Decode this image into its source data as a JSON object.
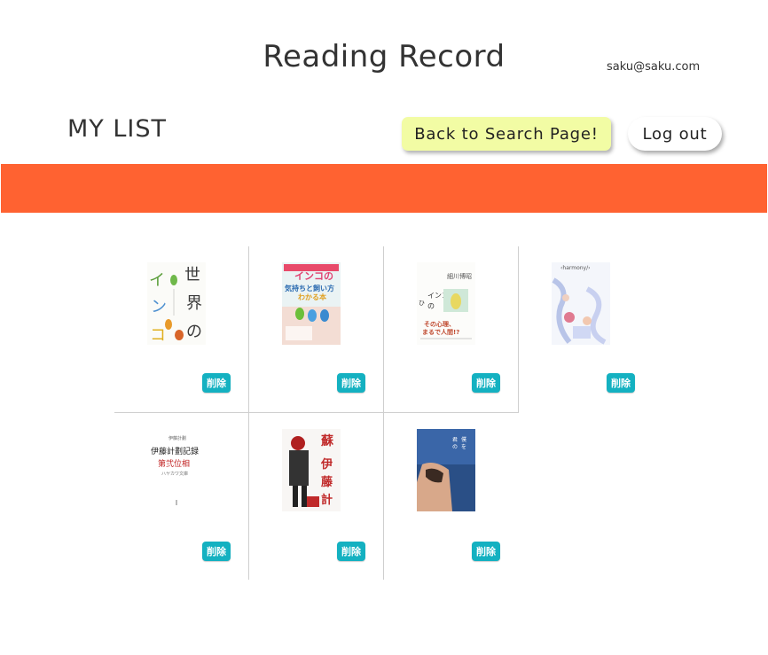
{
  "header": {
    "site_title": "Reading Record",
    "user_email": "saku@saku.com"
  },
  "toolbar": {
    "list_title": "MY LIST",
    "search_button_label": "Back to Search Page!",
    "logout_button_label": "Log out"
  },
  "colors": {
    "banner": "#ff6231",
    "search_button": "#f2fca4",
    "delete_button": "#14b1c1"
  },
  "books": [
    {
      "cover_icon": "book-cover-parakeet-world-icon",
      "delete_label": "削除"
    },
    {
      "cover_icon": "book-cover-parakeet-care-icon",
      "delete_label": "削除"
    },
    {
      "cover_icon": "book-cover-parakeet-secrets-icon",
      "delete_label": "削除"
    },
    {
      "cover_icon": "book-cover-harmony-icon",
      "delete_label": "削除"
    },
    {
      "cover_icon": "book-cover-project-itoh-record-icon",
      "delete_label": "削除"
    },
    {
      "cover_icon": "book-cover-project-itoh-revival-icon",
      "delete_label": "削除"
    },
    {
      "cover_icon": "book-cover-blue-movie-icon",
      "delete_label": "削除"
    }
  ]
}
